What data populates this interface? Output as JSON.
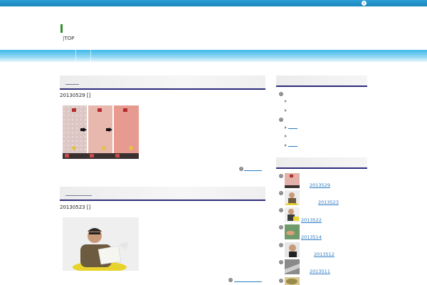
{
  "header": {
    "breadcrumb": "|TOP",
    "topbar_icon": "arrow-circle-icon"
  },
  "posts": [
    {
      "date": "20130529 []",
      "more_icon": "arrow-circle-icon"
    },
    {
      "date": "20130523 []",
      "more_icon": "arrow-circle-icon"
    }
  ],
  "sidebar": {
    "recent": [
      {
        "label": "2013529"
      },
      {
        "label": "2013523"
      },
      {
        "label": "2013522"
      },
      {
        "label": "2013514"
      },
      {
        "label": "2013512"
      },
      {
        "label": "2013511"
      }
    ]
  },
  "colors": {
    "topbar": "#1a86bd",
    "nav": "#3db8e8",
    "link": "#2a7bc4",
    "heading_rule": "#2c2c7a",
    "logo_accent": "#2f8f2f"
  }
}
